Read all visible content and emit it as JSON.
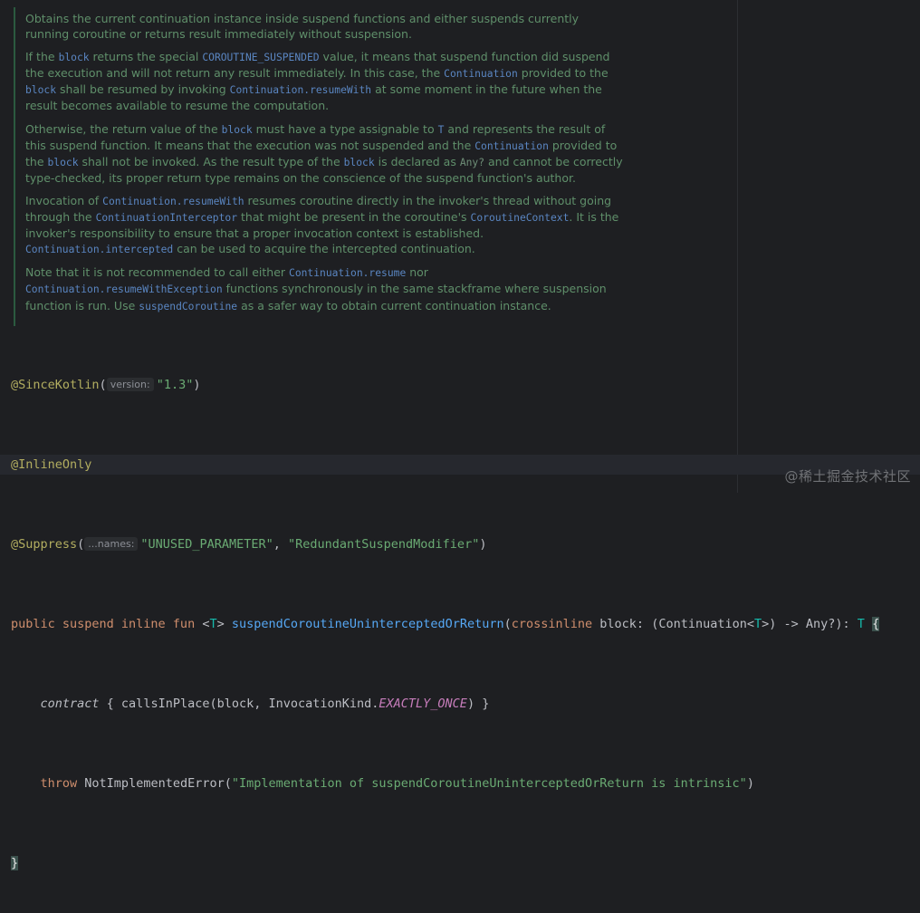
{
  "doc": {
    "p1": "Obtains the current continuation instance inside suspend functions and either suspends currently running coroutine or returns result immediately without suspension.",
    "p2": {
      "t1": "If the ",
      "c1": "block",
      "t2": " returns the special ",
      "c2": "COROUTINE_SUSPENDED",
      "t3": " value, it means that suspend function did suspend the execution and will not return any result immediately. In this case, the ",
      "c3": "Continuation",
      "t4": " provided to the ",
      "c4": "block",
      "t5": " shall be resumed by invoking ",
      "c5": "Continuation.resumeWith",
      "t6": " at some moment in the future when the result becomes available to resume the computation."
    },
    "p3": {
      "t1": "Otherwise, the return value of the ",
      "c1": "block",
      "t2": " must have a type assignable to ",
      "c2": "T",
      "t3": " and represents the result of this suspend function. It means that the execution was not suspended and the ",
      "c3": "Continuation",
      "t4": " provided to the ",
      "c4": "block",
      "t5": " shall not be invoked. As the result type of the ",
      "c5": "block",
      "t6": " is declared as ",
      "c6": "Any?",
      "t7": " and cannot be correctly type-checked, its proper return type remains on the conscience of the suspend function's author."
    },
    "p4": {
      "t1": "Invocation of ",
      "c1": "Continuation.resumeWith",
      "t2": " resumes coroutine directly in the invoker's thread without going through the ",
      "c2": "ContinuationInterceptor",
      "t3": " that might be present in the coroutine's ",
      "c3": "CoroutineContext",
      "t4": ". It is the invoker's responsibility to ensure that a proper invocation context is established. ",
      "c4": "Continuation.intercepted",
      "t5": " can be used to acquire the intercepted continuation."
    },
    "p5": {
      "t1": "Note that it is not recommended to call either ",
      "c1": "Continuation.resume",
      "t2": " nor ",
      "c2": "Continuation.resumeWithException",
      "t3": " functions synchronously in the same stackframe where suspension function is run. Use ",
      "c3": "suspendCoroutine",
      "t4": " as a safer way to obtain current continuation instance."
    }
  },
  "code": {
    "l1": {
      "ann": "@SinceKotlin",
      "open": "(",
      "hint": "version:",
      "str": "\"1.3\"",
      "close": ")"
    },
    "l2": {
      "ann": "@InlineOnly"
    },
    "l3": {
      "ann": "@Suppress",
      "open": "(",
      "hint": "...names:",
      "str1": "\"UNUSED_PARAMETER\"",
      "sep": ", ",
      "str2": "\"RedundantSuspendModifier\"",
      "close": ")"
    },
    "l4": {
      "kw": "public suspend inline fun ",
      "lt": "<",
      "tp1": "T",
      "gt": "> ",
      "fn": "suspendCoroutineUninterceptedOrReturn",
      "p1": "(",
      "kw2": "crossinline ",
      "p2": "block: (Continuation<",
      "tp2": "T",
      "p3": ">) -> Any?): ",
      "tp3": "T",
      "sp": " ",
      "brace": "{"
    },
    "l5": {
      "it": "contract",
      "rest1": " { callsInPlace(block, InvocationKind.",
      "const": "EXACTLY_ONCE",
      "rest2": ") }"
    },
    "l6": {
      "kw": "throw ",
      "rest1": "NotImplementedError(",
      "str": "\"Implementation of suspendCoroutineUninterceptedOrReturn is intrinsic\"",
      "rest2": ")"
    },
    "l7": {
      "brace": "}"
    }
  },
  "watermark": "@稀土掘金技术社区"
}
